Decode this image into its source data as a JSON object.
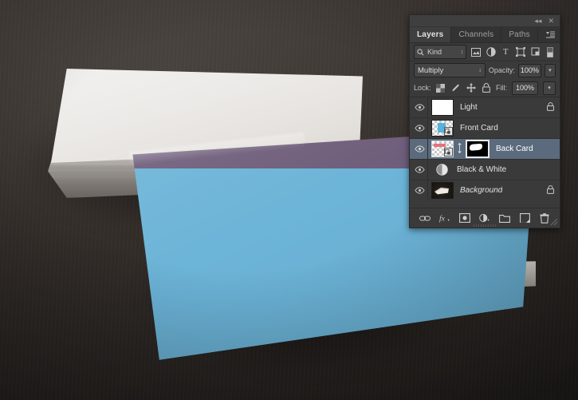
{
  "panel": {
    "titlebar": {
      "collapse_label": "◂◂",
      "close_label": "✕"
    },
    "tabs": [
      {
        "label": "Layers",
        "active": true
      },
      {
        "label": "Channels",
        "active": false
      },
      {
        "label": "Paths",
        "active": false
      }
    ],
    "panel_menu_label": "☰",
    "filter": {
      "search_icon": "search-icon",
      "kind_value": "Kind",
      "stepper": "↕",
      "icons": [
        {
          "name": "filter-pixel-icon",
          "glyph": "image"
        },
        {
          "name": "filter-adjustment-icon",
          "glyph": "adjustment"
        },
        {
          "name": "filter-type-icon",
          "glyph": "T"
        },
        {
          "name": "filter-shape-icon",
          "glyph": "shape"
        },
        {
          "name": "filter-smart-object-icon",
          "glyph": "smart"
        },
        {
          "name": "filter-toggle-icon",
          "glyph": "toggle"
        }
      ]
    },
    "blend": {
      "mode": "Multiply",
      "opacity_label": "Opacity:",
      "opacity_value": "100%",
      "arrow": "▾"
    },
    "lock": {
      "label": "Lock:",
      "items": [
        {
          "name": "lock-transparent-pixels-icon",
          "glyph": "checker"
        },
        {
          "name": "lock-image-pixels-icon",
          "glyph": "brush"
        },
        {
          "name": "lock-position-icon",
          "glyph": "move"
        },
        {
          "name": "lock-all-icon",
          "glyph": "lock"
        }
      ],
      "fill_label": "Fill:",
      "fill_value": "100%",
      "arrow": "▾"
    },
    "layers": [
      {
        "name": "Light",
        "visible": true,
        "selected": false,
        "thumb": "white",
        "has_mask": false,
        "linked": false,
        "smart_object": false,
        "locked": true,
        "italic": false
      },
      {
        "name": "Front Card",
        "visible": true,
        "selected": false,
        "thumb": "blue-artwork",
        "has_mask": false,
        "linked": false,
        "smart_object": true,
        "locked": false,
        "italic": false
      },
      {
        "name": "Back Card",
        "visible": true,
        "selected": true,
        "thumb": "pink-artwork",
        "has_mask": true,
        "linked": true,
        "smart_object": true,
        "locked": false,
        "italic": false
      },
      {
        "name": "Black & White",
        "visible": true,
        "selected": false,
        "thumb": "adjustment",
        "has_mask": false,
        "linked": false,
        "smart_object": false,
        "locked": false,
        "italic": false
      },
      {
        "name": "Background",
        "visible": true,
        "selected": false,
        "thumb": "photo",
        "has_mask": false,
        "linked": false,
        "smart_object": false,
        "locked": true,
        "italic": true
      }
    ],
    "bottom_buttons": [
      {
        "name": "link-layers-button",
        "glyph": "link"
      },
      {
        "name": "layer-style-button",
        "glyph": "fx"
      },
      {
        "name": "add-layer-mask-button",
        "glyph": "mask"
      },
      {
        "name": "new-adjustment-layer-button",
        "glyph": "adjustment"
      },
      {
        "name": "new-group-button",
        "glyph": "folder"
      },
      {
        "name": "new-layer-button",
        "glyph": "newlayer"
      },
      {
        "name": "delete-layer-button",
        "glyph": "trash"
      }
    ]
  },
  "canvas": {
    "description": "Business card mockup photo",
    "colors": {
      "background_desk": "#3a3430",
      "card_blue": "#6cb4d8",
      "card_purple": "#6f5e7b",
      "stack_white": "#ecebe8",
      "selection_blue": "#5b6b7d"
    }
  }
}
